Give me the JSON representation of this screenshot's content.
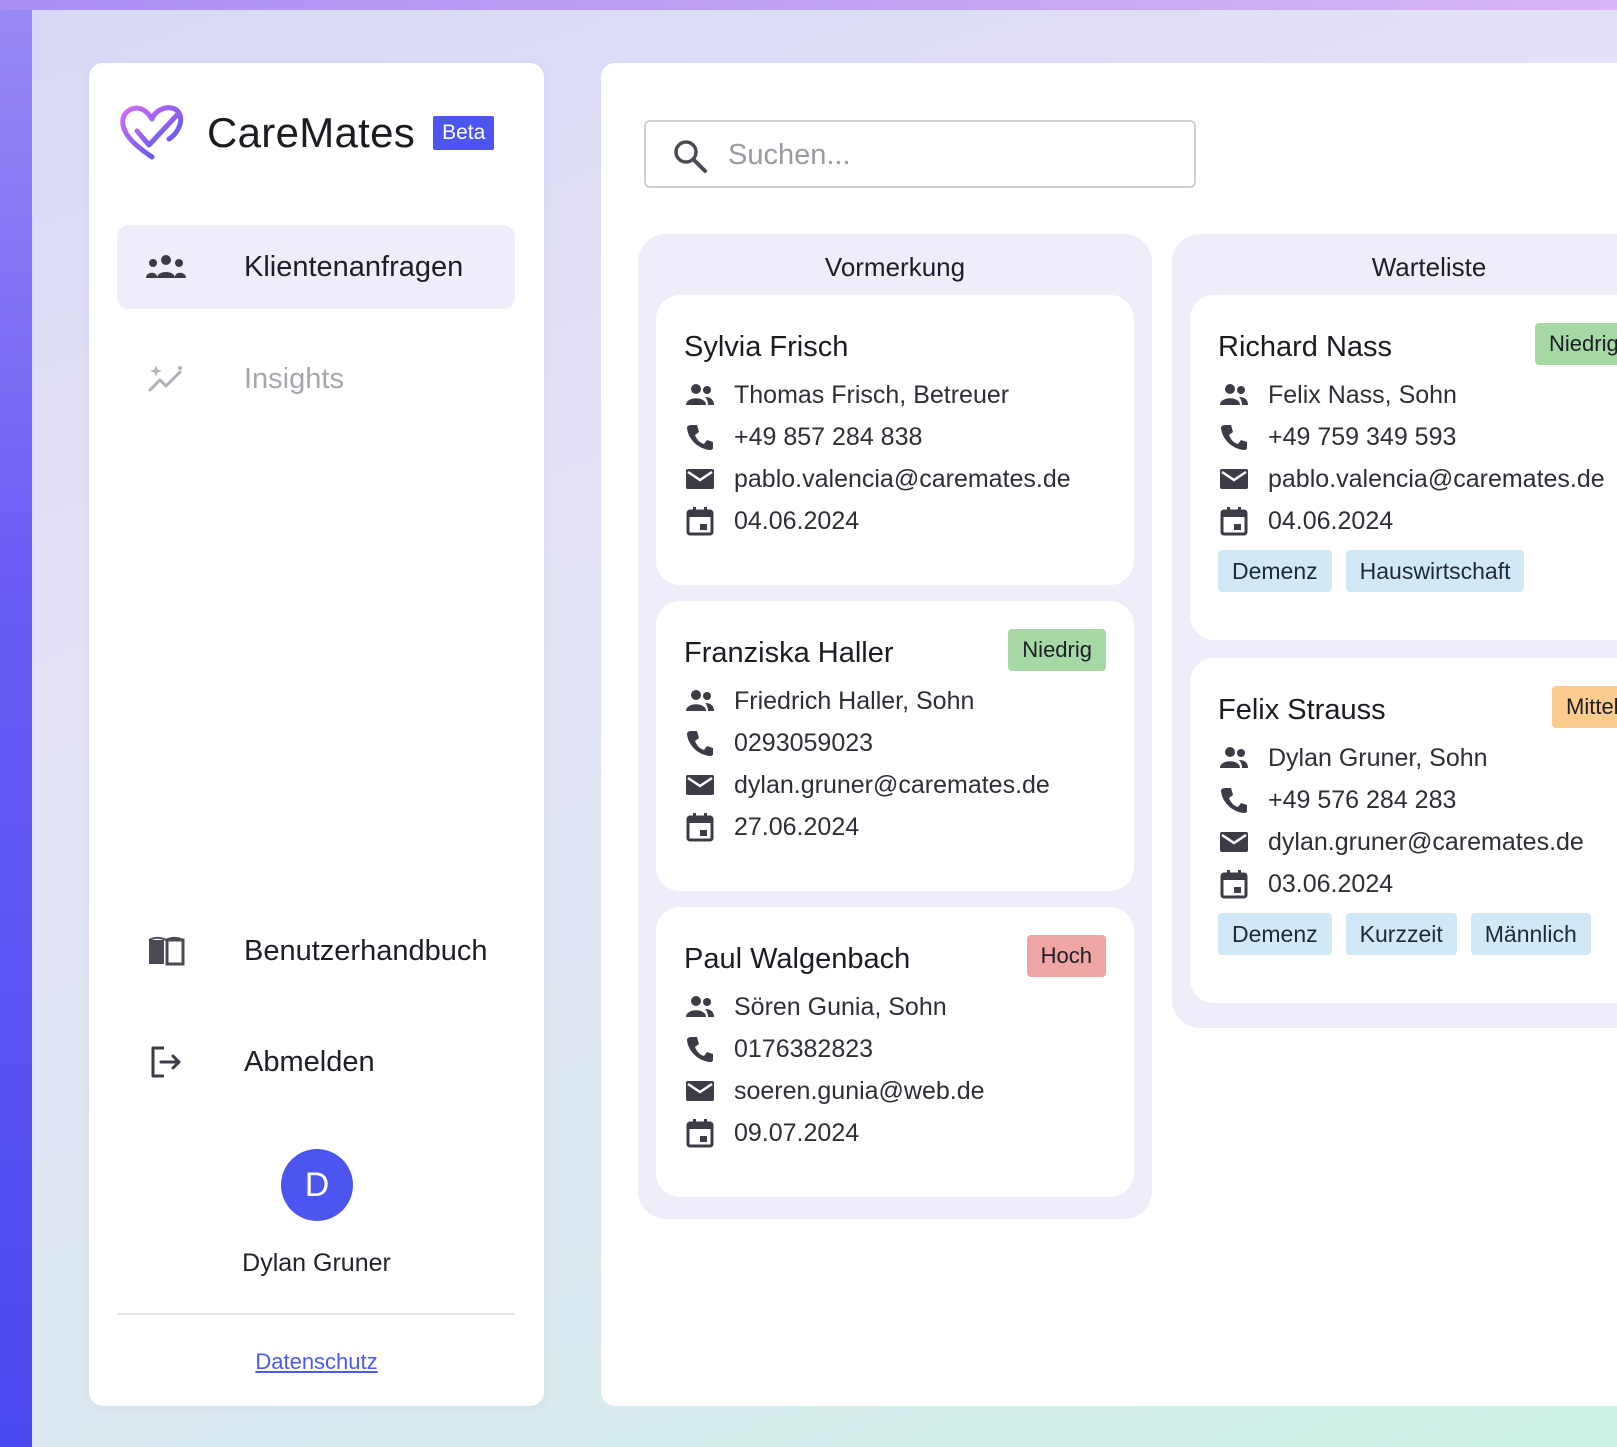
{
  "brand": {
    "name": "CareMates",
    "badge": "Beta"
  },
  "nav": {
    "clients": "Klientenanfragen",
    "insights": "Insights",
    "manual": "Benutzerhandbuch",
    "logout": "Abmelden"
  },
  "user": {
    "initial": "D",
    "name": "Dylan Gruner"
  },
  "footer": {
    "privacy": "Datenschutz"
  },
  "search": {
    "placeholder": "Suchen..."
  },
  "columns": [
    {
      "title": "Vormerkung",
      "cards": [
        {
          "name": "Sylvia Frisch",
          "priority": "",
          "contact": "Thomas Frisch, Betreuer",
          "phone": "+49 857 284 838",
          "email": "pablo.valencia@caremates.de",
          "date": "04.06.2024",
          "tags": []
        },
        {
          "name": "Franziska Haller",
          "priority": "Niedrig",
          "contact": "Friedrich Haller, Sohn",
          "phone": "0293059023",
          "email": "dylan.gruner@caremates.de",
          "date": "27.06.2024",
          "tags": []
        },
        {
          "name": "Paul Walgenbach",
          "priority": "Hoch",
          "contact": "Sören Gunia, Sohn",
          "phone": "0176382823",
          "email": "soeren.gunia@web.de",
          "date": "09.07.2024",
          "tags": []
        }
      ]
    },
    {
      "title": "Warteliste",
      "cards": [
        {
          "name": "Richard Nass",
          "priority": "Niedrig",
          "contact": "Felix Nass, Sohn",
          "phone": "+49 759 349 593",
          "email": "pablo.valencia@caremates.de",
          "date": "04.06.2024",
          "tags": [
            "Demenz",
            "Hauswirtschaft"
          ]
        },
        {
          "name": "Felix Strauss",
          "priority": "Mittel",
          "contact": "Dylan Gruner, Sohn",
          "phone": "+49 576 284 283",
          "email": "dylan.gruner@caremates.de",
          "date": "03.06.2024",
          "tags": [
            "Demenz",
            "Kurzzeit",
            "Männlich"
          ]
        }
      ]
    }
  ],
  "colors": {
    "accent": "#4c55f0",
    "low": "#a5d8a5",
    "high": "#f0a5a5",
    "mid": "#fbcc8d",
    "tag": "#d1e8f7"
  }
}
